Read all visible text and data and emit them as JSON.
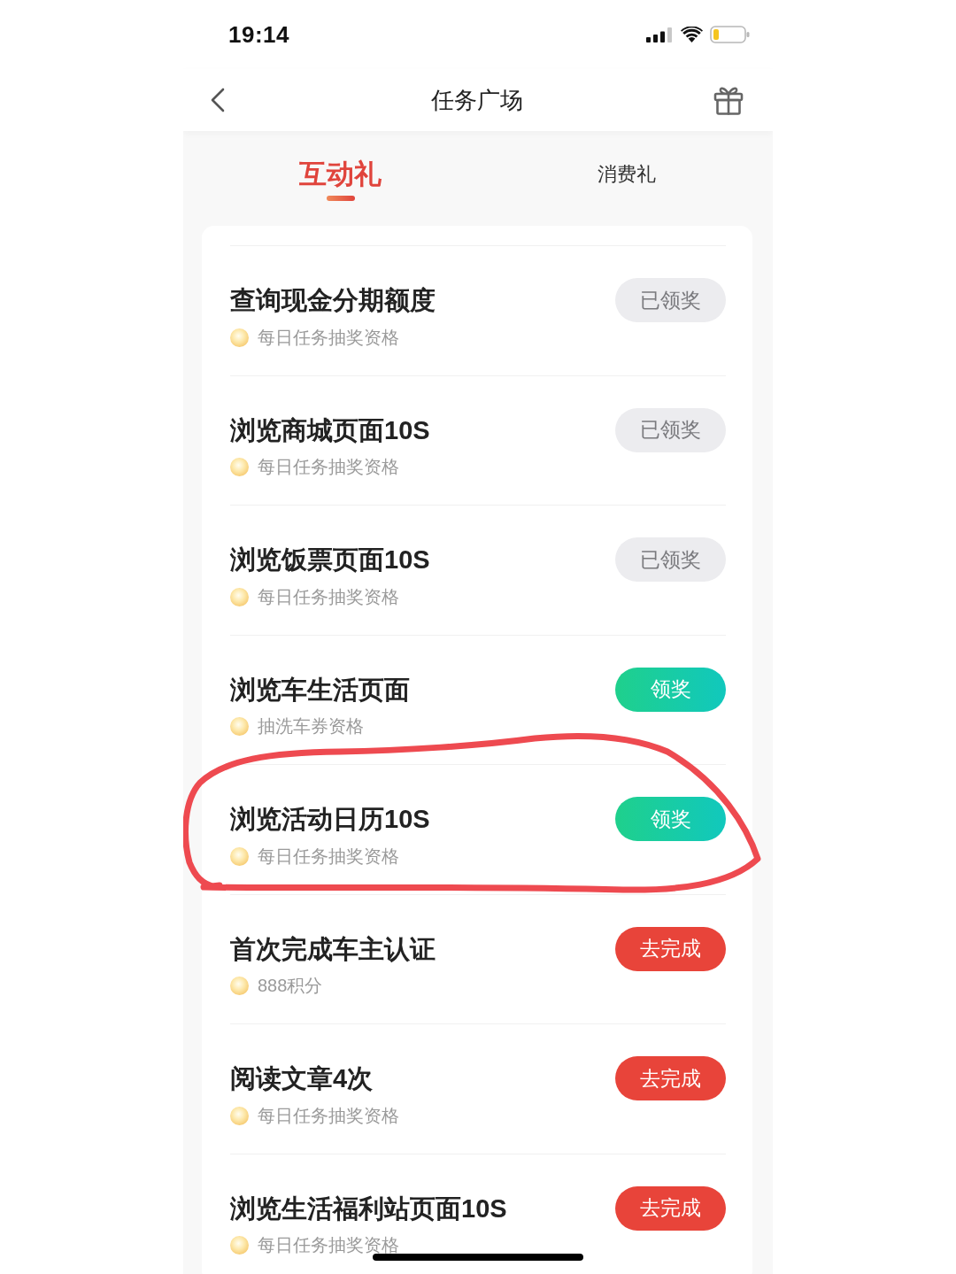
{
  "status_bar": {
    "time": "19:14"
  },
  "header": {
    "title": "任务广场"
  },
  "tabs": [
    {
      "label": "互动礼",
      "selected": true
    },
    {
      "label": "消费礼",
      "selected": false
    }
  ],
  "tasks": [
    {
      "title": "查询现金分期额度",
      "reward": "每日任务抽奖资格",
      "button": {
        "label": "已领奖",
        "kind": "claimed"
      },
      "circled": false
    },
    {
      "title": "浏览商城页面10S",
      "reward": "每日任务抽奖资格",
      "button": {
        "label": "已领奖",
        "kind": "claimed"
      },
      "circled": false
    },
    {
      "title": "浏览饭票页面10S",
      "reward": "每日任务抽奖资格",
      "button": {
        "label": "已领奖",
        "kind": "claimed"
      },
      "circled": false
    },
    {
      "title": "浏览车生活页面",
      "reward": "抽洗车券资格",
      "button": {
        "label": "领奖",
        "kind": "claim"
      },
      "circled": false
    },
    {
      "title": "浏览活动日历10S",
      "reward": "每日任务抽奖资格",
      "button": {
        "label": "领奖",
        "kind": "claim"
      },
      "circled": true
    },
    {
      "title": "首次完成车主认证",
      "reward": "888积分",
      "button": {
        "label": "去完成",
        "kind": "todo"
      },
      "circled": false
    },
    {
      "title": "阅读文章4次",
      "reward": "每日任务抽奖资格",
      "button": {
        "label": "去完成",
        "kind": "todo"
      },
      "circled": false
    },
    {
      "title": "浏览生活福利站页面10S",
      "reward": "每日任务抽奖资格",
      "button": {
        "label": "去完成",
        "kind": "todo"
      },
      "circled": false
    }
  ]
}
